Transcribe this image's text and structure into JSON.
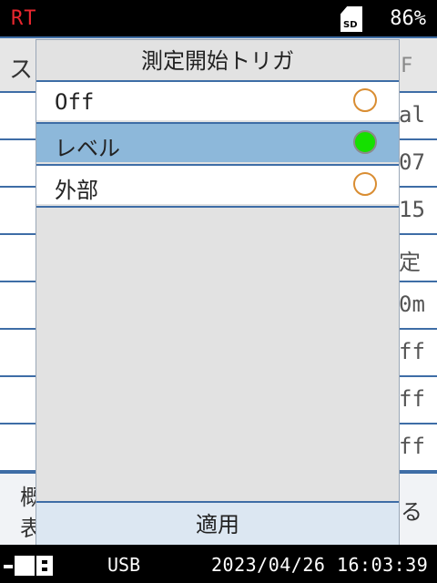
{
  "status_bar": {
    "mode": "RT",
    "sd_label": "SD",
    "battery": "86%"
  },
  "background": {
    "header_left": "ス",
    "header_right": "F",
    "row_values": [
      "al",
      "07",
      "15",
      "定",
      "0m",
      "ff",
      "ff",
      "ff"
    ],
    "bottom_left_top": "概",
    "bottom_left_bottom": "表",
    "bottom_right": "る"
  },
  "dialog": {
    "title": "測定開始トリガ",
    "options": [
      {
        "label": "Off",
        "selected": false
      },
      {
        "label": "レベル",
        "selected": true
      },
      {
        "label": "外部",
        "selected": false
      }
    ],
    "apply_label": "適用"
  },
  "footer": {
    "connection": "USB",
    "datetime": "2023/04/26  16:03:39"
  },
  "colors": {
    "accent_line": "#3e6da6",
    "selected_row": "#8db8da",
    "radio_on": "#15e000",
    "radio_off_border": "#d98d32",
    "mode_red": "#e8262e"
  }
}
